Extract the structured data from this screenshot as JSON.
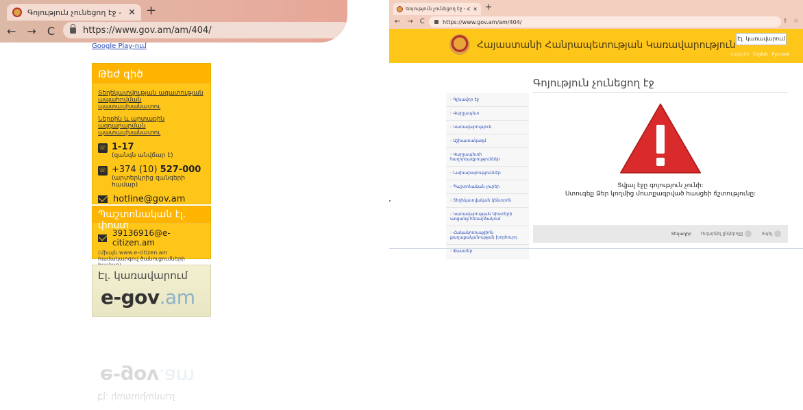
{
  "left_browser": {
    "tab_title": "Գոյություն չունեցող էջ - Հայս",
    "url": "https://www.gov.am/am/404/",
    "top_note": "Google Play-ում",
    "hotline": {
      "heading": "Թեժ գիծ",
      "link": "Տեղեկատվության ազատության ապահովման պատասխանատու",
      "text": "Ներքին և արտաքին ազդարարման պատասխանատու",
      "phone1": "1-17",
      "phone1_note": "(զանգն անվճար է)",
      "phone2_prefix": "+374 (10) ",
      "phone2_bold": "527-000",
      "phone2_note": "(արտերկրից զանգերի համար)",
      "email": "hotline@gov.am"
    },
    "official_mail": {
      "heading": "Պաշտոնական էլ. փոստ",
      "email": "39136916@e-citizen.am",
      "note": "(միայն www.e-citizen.am համակարգով ծանուցումների համար)"
    },
    "egov": {
      "heading": "Էլ. կառավարում",
      "logo_main": "e-gov",
      "logo_suffix": ".am"
    }
  },
  "right_browser": {
    "tab_title": "Գոյություն չունեցող էջ - Հայա",
    "url": "https://www.gov.am/am/404/",
    "header_title": "Հայաստանի Հանրապետության Կառավարություն",
    "egov_button": "Էլ. կառավարում",
    "langs": [
      "Հայերեն",
      "English",
      "Русский"
    ],
    "sidebar": [
      "Գլխավոր էջ",
      "Վարչապետ",
      "Կառավարություն",
      "Աշխատակազմ",
      "Վարչապետի հաղորդագրություններ",
      "Նախարարություններ",
      "Պաշտոնական լուրեր",
      "Տեղեկատվական կենտրոն",
      "Կառավարության նիստերի առցանց հեռարձակում",
      "Հակակոռուպցիոն քաղաքականության խորհուրդ",
      "Փաստեր"
    ],
    "page_title": "Գոյություն չունեցող էջ",
    "message_line1": "Տվյալ էջը գոյություն չունի:",
    "message_line2": "Ստուգեք Ձեր կողմից մուտքագրված հասցեի ճշտությունը:",
    "back_label": "Տեղադիր",
    "share_label": "Ուղարկել ընկերոջը",
    "print_label": "Տպել"
  }
}
